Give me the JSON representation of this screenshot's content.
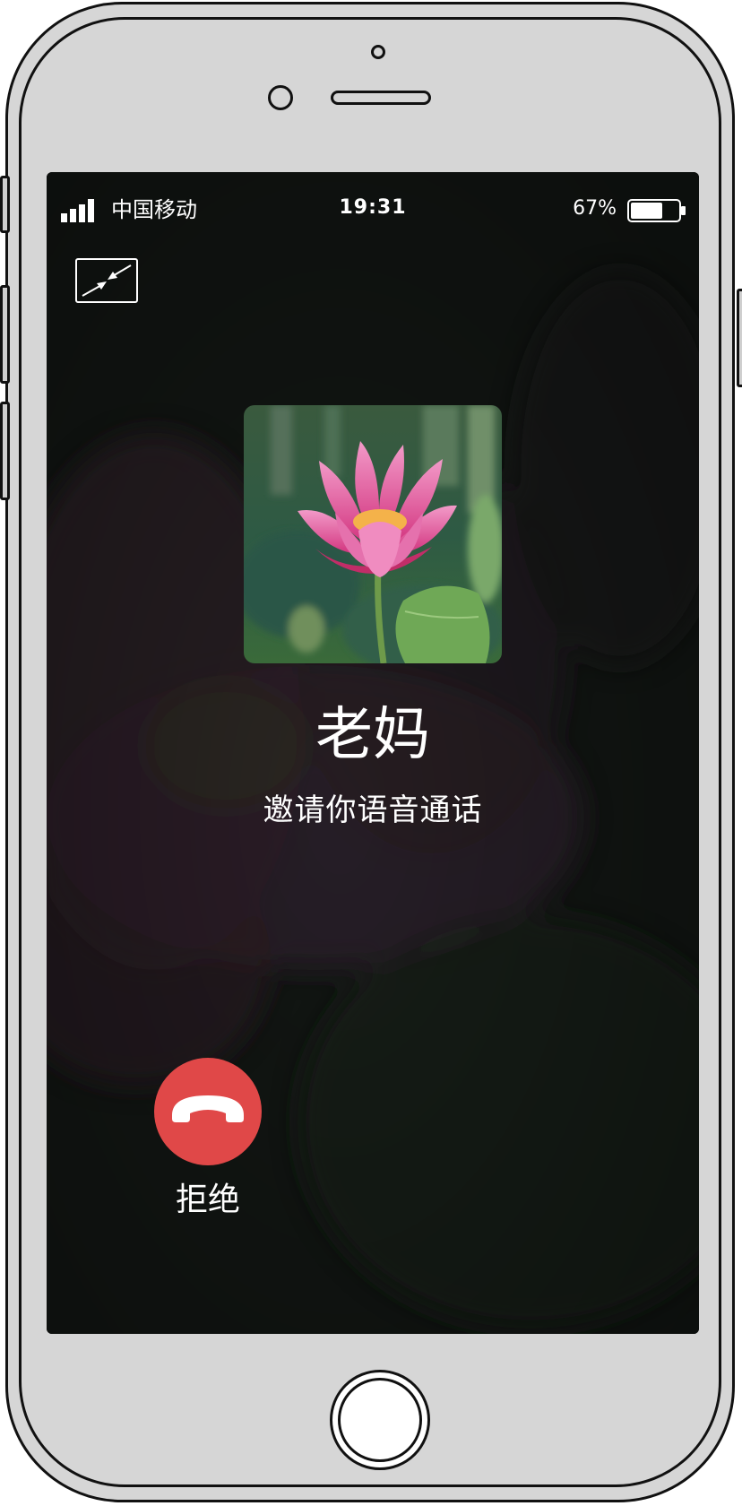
{
  "status_bar": {
    "carrier": "中国移动",
    "time": "19:31",
    "battery_percent": "67%",
    "battery_level": 0.67,
    "signal_bars": 4
  },
  "call": {
    "caller_name": "老妈",
    "subtitle": "邀请你语音通话",
    "decline_label": "拒绝"
  },
  "icons": {
    "minimize": "minimize-arrows-icon",
    "decline": "phone-hangup-icon",
    "avatar": "lotus-flower-photo"
  },
  "colors": {
    "decline": "#e04848",
    "screen_bg": "#121614",
    "text": "#ffffff"
  }
}
